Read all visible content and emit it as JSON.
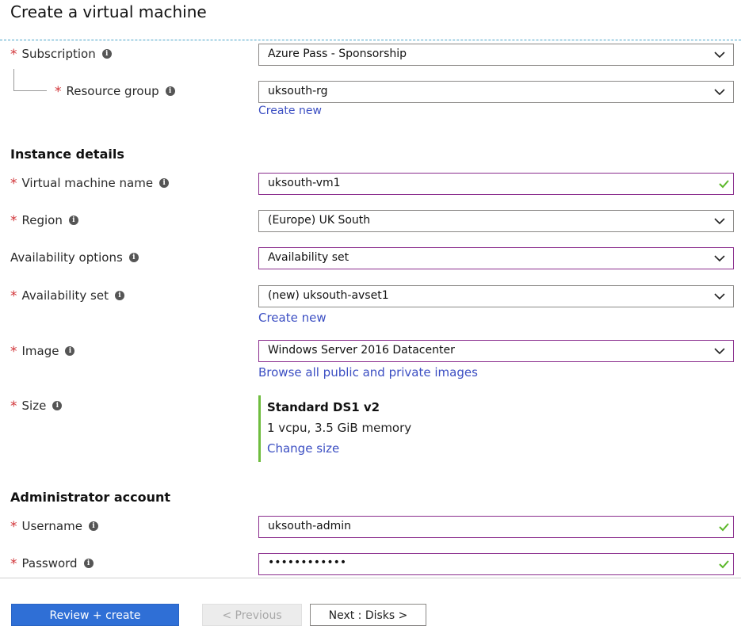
{
  "page": {
    "title": "Create a virtual machine"
  },
  "project": {
    "subscription": {
      "label": "Subscription",
      "value": "Azure Pass - Sponsorship"
    },
    "resource_group": {
      "label": "Resource group",
      "value": "uksouth-rg",
      "create_new": "Create new"
    }
  },
  "instance": {
    "heading": "Instance details",
    "vm_name": {
      "label": "Virtual machine name",
      "value": "uksouth-vm1"
    },
    "region": {
      "label": "Region",
      "value": "(Europe) UK South"
    },
    "availability_options": {
      "label": "Availability options",
      "value": "Availability set"
    },
    "availability_set": {
      "label": "Availability set",
      "value": "(new) uksouth-avset1",
      "create_new": "Create new"
    },
    "image": {
      "label": "Image",
      "value": "Windows Server 2016 Datacenter",
      "browse": "Browse all public and private images"
    },
    "size": {
      "label": "Size",
      "name": "Standard DS1 v2",
      "description": "1 vcpu, 3.5 GiB memory",
      "change": "Change size"
    }
  },
  "admin": {
    "heading": "Administrator account",
    "username": {
      "label": "Username",
      "value": "uksouth-admin"
    },
    "password": {
      "label": "Password",
      "value": "••••••••••••"
    }
  },
  "footer": {
    "review_create": "Review + create",
    "previous": "< Previous",
    "next": "Next : Disks >"
  },
  "icons": {
    "info": "info-icon",
    "chevron": "chevron-down-icon",
    "check": "check-icon"
  },
  "colors": {
    "required": "#d13438",
    "link": "#3c4fc3",
    "active_border": "#8a2d8d",
    "valid_check": "#5cb82a",
    "primary_button": "#2f6fd6"
  }
}
